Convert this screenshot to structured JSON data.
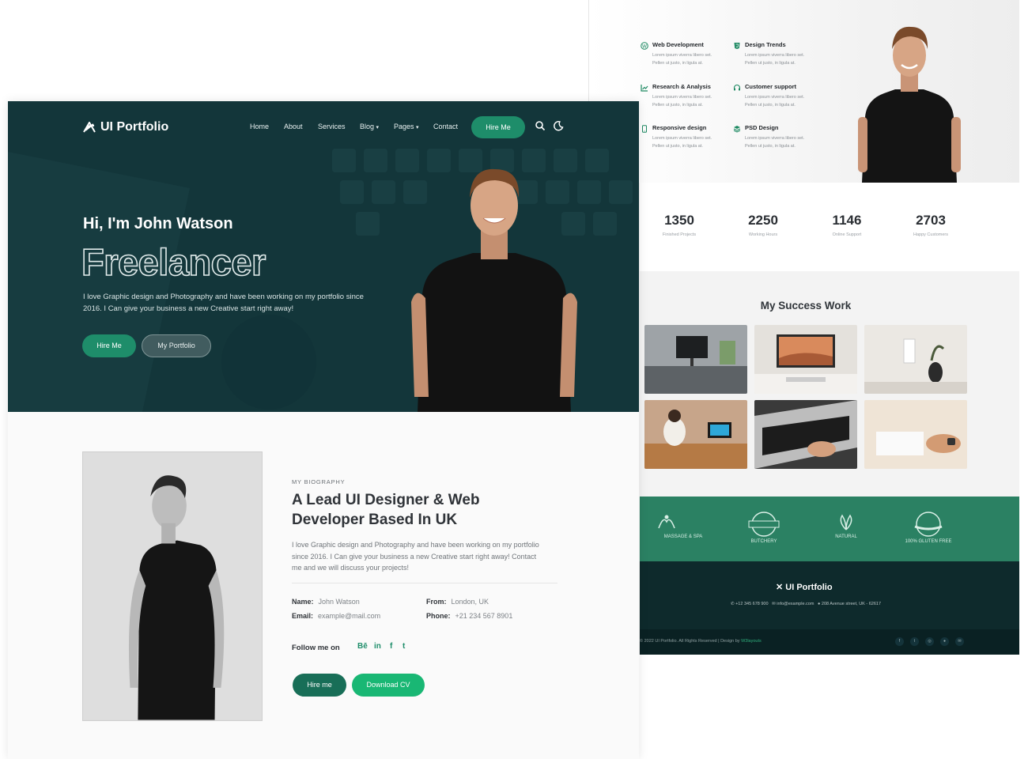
{
  "back": {
    "services": [
      {
        "icon": "wordpress-icon",
        "title": "Web Development",
        "desc1": "Lorem ipsum viverra libero set.",
        "desc2": "Pellen ut justo, in ligula at."
      },
      {
        "icon": "html5-icon",
        "title": "Design Trends",
        "desc1": "Lorem ipsum viverra libero set.",
        "desc2": "Pellen ut justo, in ligula at."
      },
      {
        "icon": "chart-icon",
        "title": "Research & Analysis",
        "desc1": "Lorem ipsum viverra libero set.",
        "desc2": "Pellen ut justo, in ligula at."
      },
      {
        "icon": "headset-icon",
        "title": "Customer support",
        "desc1": "Lorem ipsum viverra libero set.",
        "desc2": "Pellen ut justo, in ligula at."
      },
      {
        "icon": "mobile-icon",
        "title": "Responsive design",
        "desc1": "Lorem ipsum viverra libero set.",
        "desc2": "Pellen ut justo, in ligula at."
      },
      {
        "icon": "layers-icon",
        "title": "PSD Design",
        "desc1": "Lorem ipsum viverra libero set.",
        "desc2": "Pellen ut justo, in ligula at."
      }
    ],
    "stats": [
      {
        "value": "1350",
        "label": "Finished Projects"
      },
      {
        "value": "2250",
        "label": "Working Hours"
      },
      {
        "value": "1146",
        "label": "Online Support"
      },
      {
        "value": "2703",
        "label": "Happy Customers"
      }
    ],
    "works_title": "My Success Work",
    "brands": [
      "MASSAGE & SPA",
      "BUTCHERY",
      "NATURAL",
      "100% GLUTEN FREE"
    ],
    "footer": {
      "logo": "UI Portfolio",
      "phone": "+12 345 678 900",
      "email": "info@example.com",
      "address": "208 Avenue street, UK - 62617",
      "copyright": "© 2022 UI Portfolio. All Rights Reserved | Design by",
      "designer": "W3layouts"
    }
  },
  "front": {
    "logo": "UI Portfolio",
    "nav": {
      "home": "Home",
      "about": "About",
      "services": "Services",
      "blog": "Blog",
      "pages": "Pages",
      "contact": "Contact",
      "cta": "Hire Me"
    },
    "hero": {
      "greeting": "Hi, I'm John Watson",
      "role": "Freelancer",
      "intro": "I love Graphic design and Photography and have been working on my portfolio since 2016. I Can give your business a new Creative start right away!",
      "btn_hire": "Hire Me",
      "btn_portfolio": "My Portfolio"
    },
    "bio": {
      "kicker": "MY BIOGRAPHY",
      "heading": "A Lead UI Designer & Web Developer Based In UK",
      "text": "I love Graphic design and Photography and have been working on my portfolio since 2016. I Can give your business a new Creative start right away! Contact me and we will discuss your projects!",
      "name_label": "Name:",
      "name": "John Watson",
      "from_label": "From:",
      "from": "London, UK",
      "email_label": "Email:",
      "email": "example@mail.com",
      "phone_label": "Phone:",
      "phone": "+21 234 567 8901",
      "follow": "Follow me on",
      "social": [
        "Bē",
        "in",
        "f",
        "t"
      ],
      "btn_hire": "Hire me",
      "btn_cv": "Download CV"
    }
  },
  "colors": {
    "hero_bg": "#14383c",
    "accent": "#1e8d6a",
    "accent_bright": "#19b774",
    "brands_bg": "#2b8163",
    "footer_bg": "#0e2a2c"
  }
}
